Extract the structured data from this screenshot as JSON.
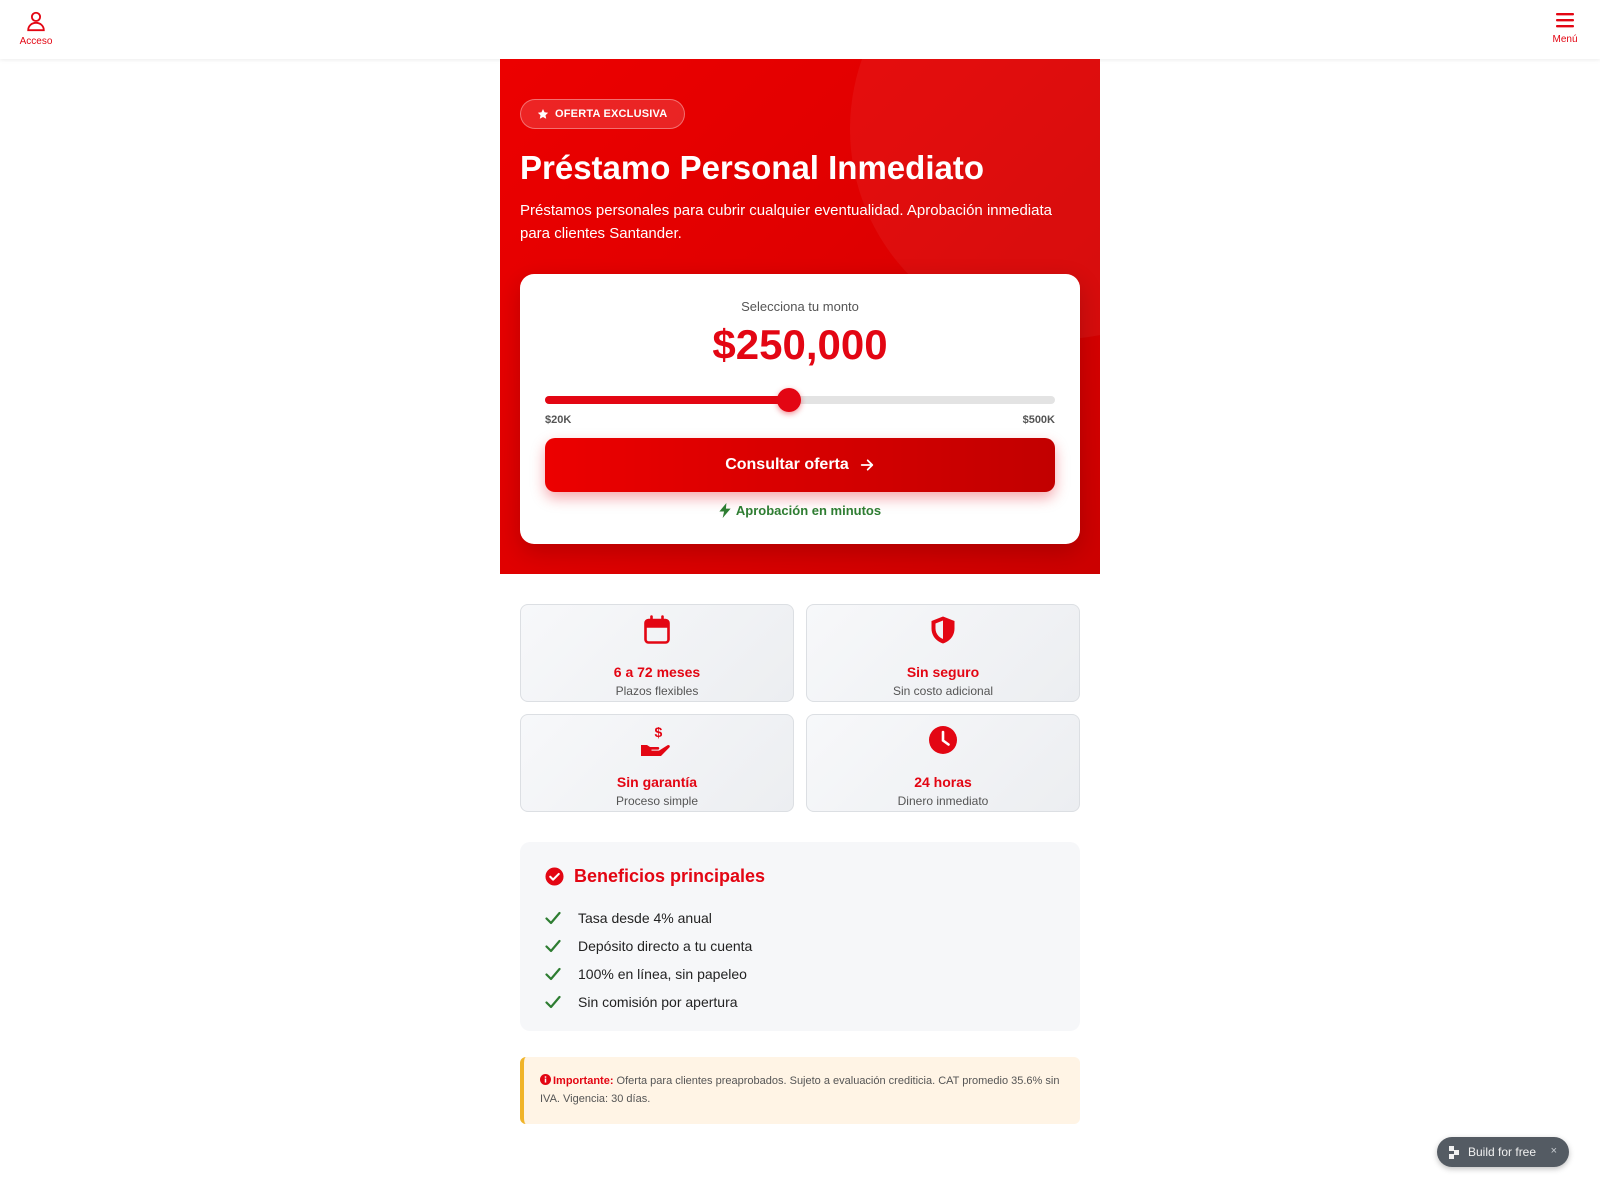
{
  "nav": {
    "left_label": "Acceso",
    "left_icon": "user-icon",
    "right_label": "Menú",
    "right_icon": "hamburger-menu-icon"
  },
  "hero": {
    "badge": "OFERTA EXCLUSIVA",
    "badge_icon": "star-icon",
    "title": "Préstamo Personal Inmediato",
    "subtitle": "Préstamos personales para cubrir cualquier eventualidad. Aprobación inmediata para clientes Santander."
  },
  "calculator": {
    "label": "Selecciona tu monto",
    "amount": "$250,000",
    "slider": {
      "min": 20000,
      "max": 500000,
      "value": 250000
    },
    "min_label": "$20K",
    "max_label": "$500K",
    "cta_label": "Consultar oferta",
    "cta_icon": "arrow-right-icon",
    "approval": "Aprobación en minutos",
    "approval_icon": "lightning-icon"
  },
  "features": [
    {
      "icon": "calendar-icon",
      "title": "6 a 72 meses",
      "subtitle": "Plazos flexibles"
    },
    {
      "icon": "shield-icon",
      "title": "Sin seguro",
      "subtitle": "Sin costo adicional"
    },
    {
      "icon": "hand-dollar-icon",
      "title": "Sin garantía",
      "subtitle": "Proceso simple"
    },
    {
      "icon": "clock-icon",
      "title": "24 horas",
      "subtitle": "Dinero inmediato"
    }
  ],
  "benefits": {
    "title": "Beneficios principales",
    "items": [
      "Tasa desde 4% anual",
      "Depósito directo a tu cuenta",
      "100% en línea, sin papeleo",
      "Sin comisión por apertura"
    ]
  },
  "notice": {
    "label": "Importante:",
    "text": " Oferta para clientes preaprobados. Sujeto a evaluación crediticia. CAT promedio 35.6% sin IVA. Vigencia: 30 días."
  },
  "build_pill": {
    "label": "Build for free",
    "close": "×"
  },
  "colors": {
    "brand": "#e30613",
    "success": "#2e7d32",
    "warning": "#f0b429"
  }
}
